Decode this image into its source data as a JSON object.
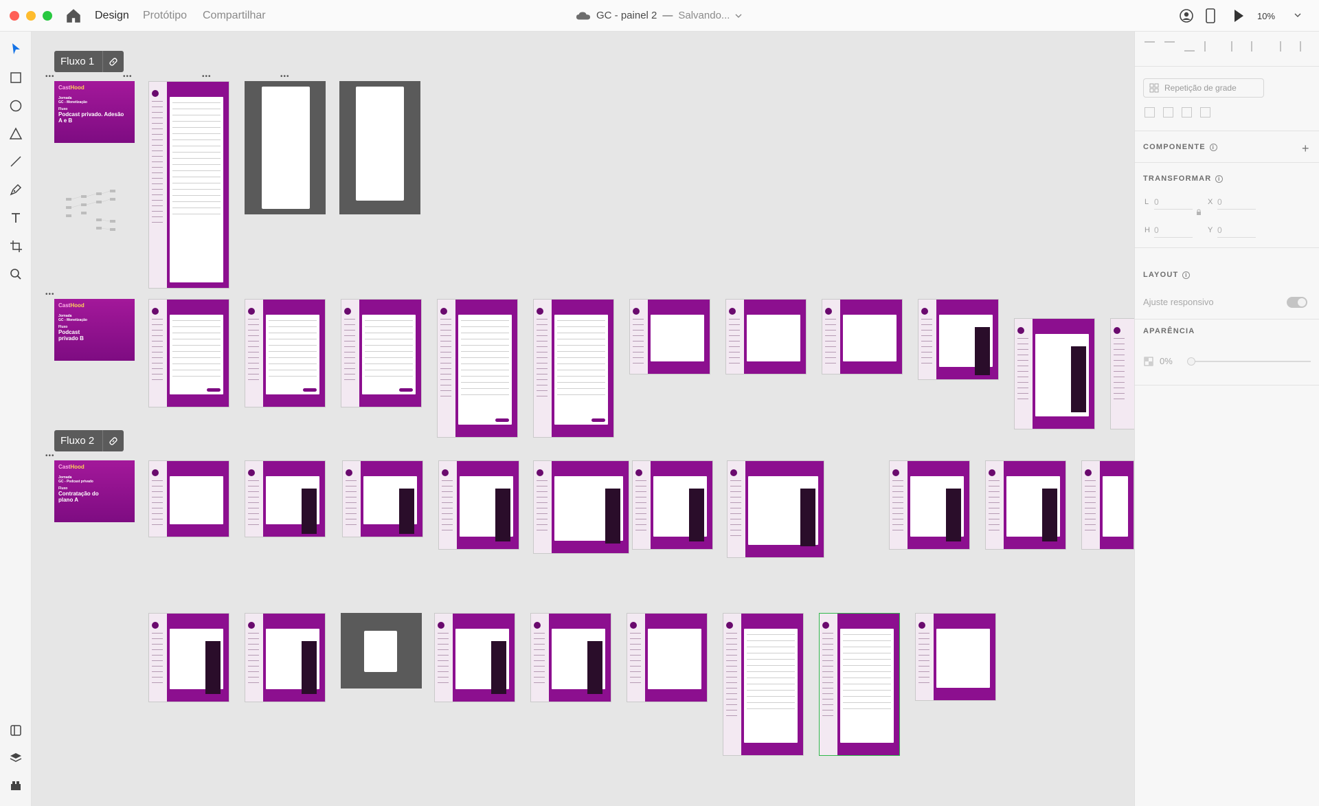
{
  "titlebar": {
    "tabs": {
      "design": "Design",
      "prototype": "Protótipo",
      "share": "Compartilhar"
    },
    "document_title": "GC - painel 2",
    "separator": "—",
    "status": "Salvando...",
    "zoom": "10%"
  },
  "canvas": {
    "flow1_label": "Fluxo 1",
    "flow2_label": "Fluxo 2",
    "cards": {
      "c1": {
        "logo_a": "Cast",
        "logo_b": "Hood",
        "journey_lbl": "Jornada",
        "journey": "GC - Monetização",
        "flow_lbl": "Fluxo",
        "flow": "Podcast privado. Adesão A e B"
      },
      "c2": {
        "logo_a": "Cast",
        "logo_b": "Hood",
        "journey_lbl": "Jornada",
        "journey": "GC - Monetização",
        "flow_lbl": "Fluxo",
        "flow": "Podcast privado B"
      },
      "c3": {
        "logo_a": "Cast",
        "logo_b": "Hood",
        "journey_lbl": "Jornada",
        "journey": "GC - Podcast privado",
        "flow_lbl": "Fluxo",
        "flow": "Contratação do plano A"
      }
    }
  },
  "right_panel": {
    "grid_repeat": "Repetição de grade",
    "component": "COMPONENTE",
    "transform": "TRANSFORMAR",
    "fields": {
      "w_lbl": "L",
      "w": "0",
      "x_lbl": "X",
      "x": "0",
      "h_lbl": "H",
      "h": "0",
      "y_lbl": "Y",
      "y": "0"
    },
    "layout": "LAYOUT",
    "responsive": "Ajuste responsivo",
    "appearance": "APARÊNCIA",
    "opacity": "0%"
  },
  "icons": [
    "home-icon",
    "cloud-icon",
    "user-icon",
    "device-icon",
    "play-icon",
    "select-icon",
    "rectangle-icon",
    "ellipse-icon",
    "triangle-icon",
    "line-icon",
    "pen-icon",
    "text-icon",
    "artboard-icon",
    "zoom-icon",
    "link-icon",
    "plugins-icon",
    "layers-icon",
    "assets-icon"
  ],
  "colors": {
    "brand_purple": "#8c0f8f",
    "canvas_bg": "#e6e6e6",
    "flow_label_bg": "#5b5b5b"
  }
}
